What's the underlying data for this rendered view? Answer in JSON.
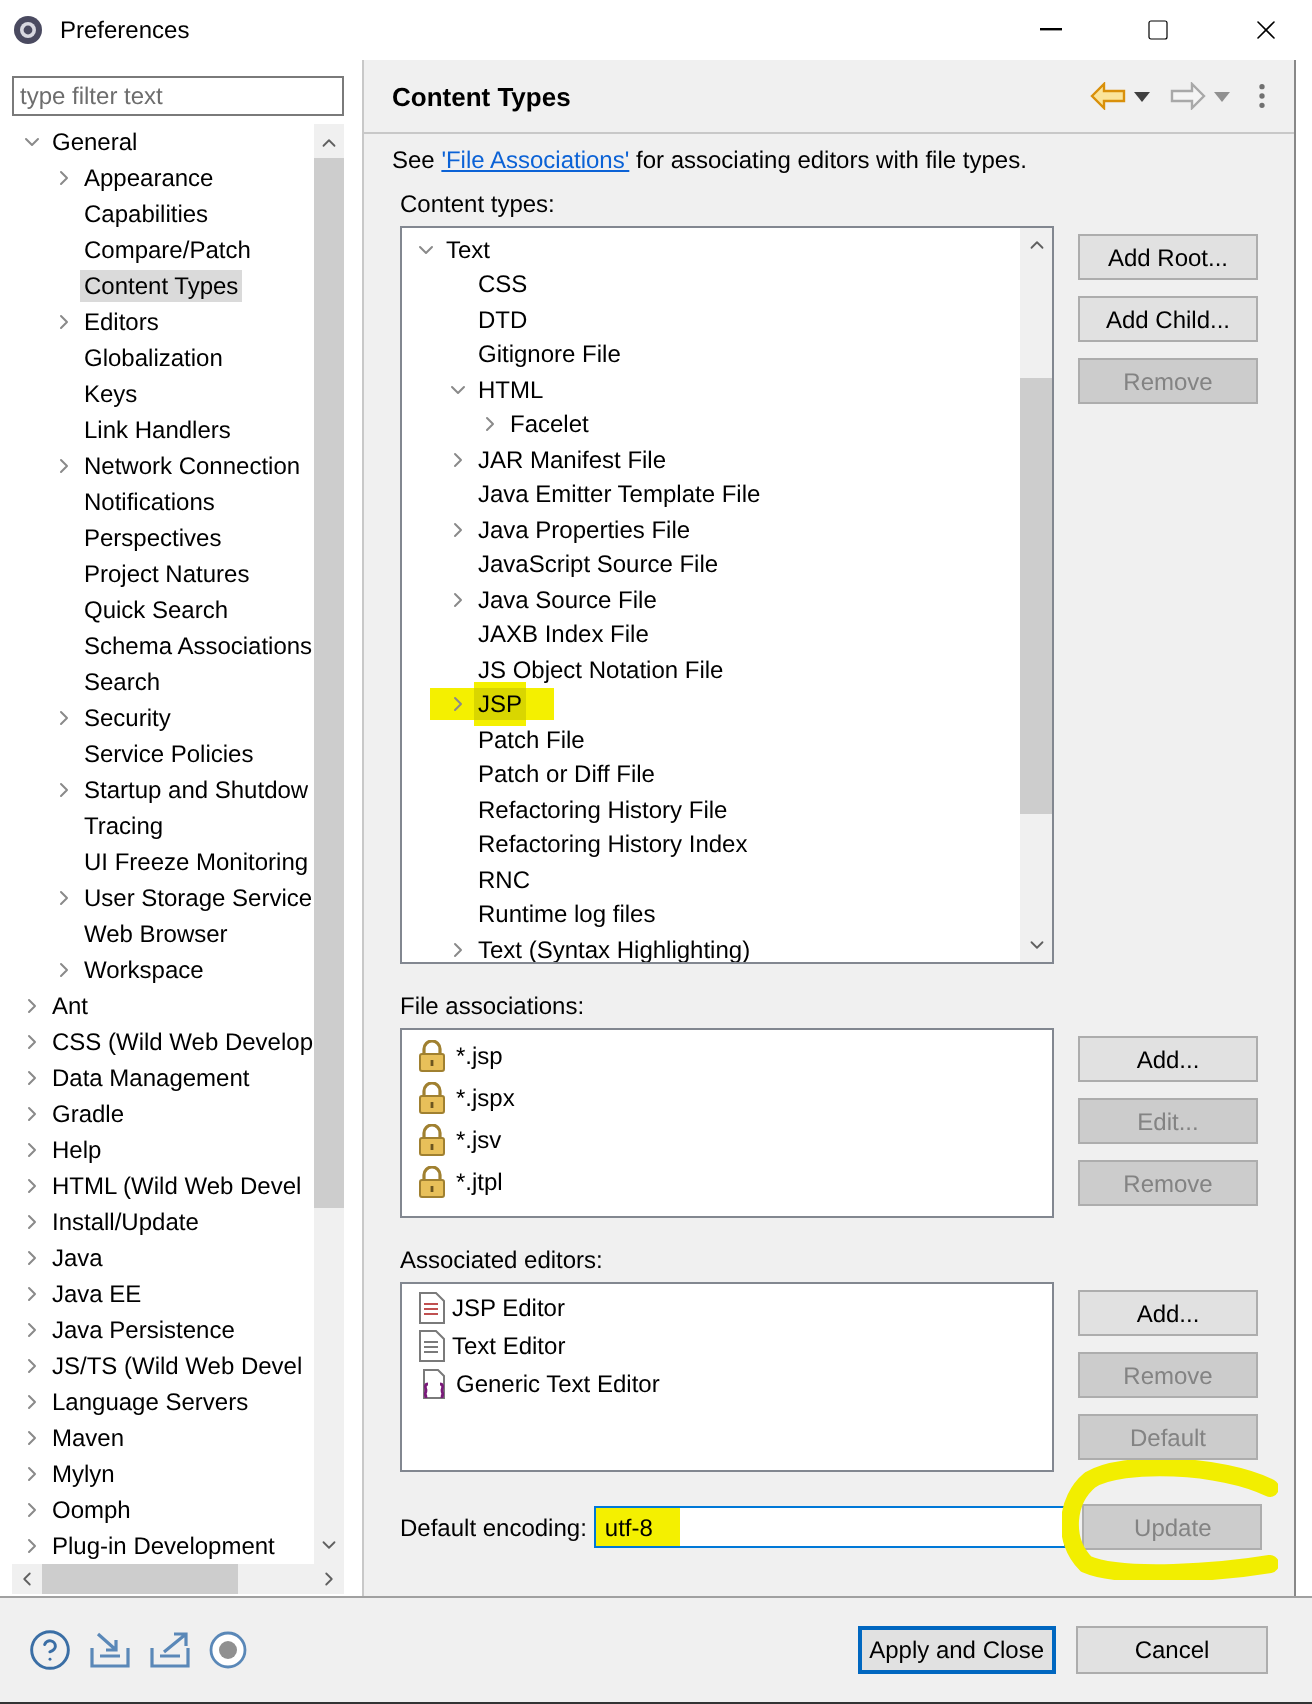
{
  "window": {
    "title": "Preferences"
  },
  "filter": {
    "placeholder": "type filter text"
  },
  "nav_tree": [
    {
      "label": "General",
      "expanded": true,
      "selected": false,
      "children": [
        {
          "label": "Appearance",
          "expanded": false,
          "selected": false
        },
        {
          "label": "Capabilities",
          "selected": false
        },
        {
          "label": "Compare/Patch",
          "selected": false
        },
        {
          "label": "Content Types",
          "selected": true
        },
        {
          "label": "Editors",
          "expanded": false,
          "selected": false
        },
        {
          "label": "Globalization",
          "selected": false
        },
        {
          "label": "Keys",
          "selected": false
        },
        {
          "label": "Link Handlers",
          "selected": false
        },
        {
          "label": "Network Connection",
          "expanded": false,
          "selected": false
        },
        {
          "label": "Notifications",
          "selected": false
        },
        {
          "label": "Perspectives",
          "selected": false
        },
        {
          "label": "Project Natures",
          "selected": false
        },
        {
          "label": "Quick Search",
          "selected": false
        },
        {
          "label": "Schema Associations",
          "selected": false
        },
        {
          "label": "Search",
          "selected": false
        },
        {
          "label": "Security",
          "expanded": false,
          "selected": false
        },
        {
          "label": "Service Policies",
          "selected": false
        },
        {
          "label": "Startup and Shutdow",
          "expanded": false,
          "selected": false
        },
        {
          "label": "Tracing",
          "selected": false
        },
        {
          "label": "UI Freeze Monitoring",
          "selected": false
        },
        {
          "label": "User Storage Service",
          "expanded": false,
          "selected": false
        },
        {
          "label": "Web Browser",
          "selected": false
        },
        {
          "label": "Workspace",
          "expanded": false,
          "selected": false
        }
      ]
    },
    {
      "label": "Ant",
      "expanded": false,
      "selected": false
    },
    {
      "label": "CSS (Wild Web Develop",
      "expanded": false,
      "selected": false
    },
    {
      "label": "Data Management",
      "expanded": false,
      "selected": false
    },
    {
      "label": "Gradle",
      "expanded": false,
      "selected": false
    },
    {
      "label": "Help",
      "expanded": false,
      "selected": false
    },
    {
      "label": "HTML (Wild Web Devel",
      "expanded": false,
      "selected": false
    },
    {
      "label": "Install/Update",
      "expanded": false,
      "selected": false
    },
    {
      "label": "Java",
      "expanded": false,
      "selected": false
    },
    {
      "label": "Java EE",
      "expanded": false,
      "selected": false
    },
    {
      "label": "Java Persistence",
      "expanded": false,
      "selected": false
    },
    {
      "label": "JS/TS (Wild Web Devel",
      "expanded": false,
      "selected": false
    },
    {
      "label": "Language Servers",
      "expanded": false,
      "selected": false
    },
    {
      "label": "Maven",
      "expanded": false,
      "selected": false
    },
    {
      "label": "Mylyn",
      "expanded": false,
      "selected": false
    },
    {
      "label": "Oomph",
      "expanded": false,
      "selected": false
    },
    {
      "label": "Plug-in Development",
      "expanded": false,
      "selected": false
    }
  ],
  "page": {
    "title": "Content Types",
    "intro": {
      "before": "See ",
      "link": "'File Associations'",
      "after": " for associating editors with file types."
    },
    "content_types": {
      "label": "Content types:",
      "tree": [
        {
          "label": "Text",
          "expanded": true,
          "selected": false,
          "children": [
            {
              "label": "CSS",
              "selected": false
            },
            {
              "label": "DTD",
              "selected": false
            },
            {
              "label": "Gitignore File",
              "selected": false
            },
            {
              "label": "HTML",
              "expanded": true,
              "selected": false,
              "children": [
                {
                  "label": "Facelet",
                  "expanded": false,
                  "selected": false
                }
              ]
            },
            {
              "label": "JAR Manifest File",
              "expanded": false,
              "selected": false
            },
            {
              "label": "Java Emitter Template File",
              "selected": false
            },
            {
              "label": "Java Properties File",
              "expanded": false,
              "selected": false
            },
            {
              "label": "JavaScript Source File",
              "selected": false
            },
            {
              "label": "Java Source File",
              "expanded": false,
              "selected": false
            },
            {
              "label": "JAXB Index File",
              "selected": false
            },
            {
              "label": "JS Object Notation File",
              "selected": false
            },
            {
              "label": "JSP",
              "expanded": false,
              "selected": true,
              "marked": true
            },
            {
              "label": "Patch File",
              "selected": false
            },
            {
              "label": "Patch or Diff File",
              "selected": false
            },
            {
              "label": "Refactoring History File",
              "selected": false
            },
            {
              "label": "Refactoring History Index",
              "selected": false
            },
            {
              "label": "RNC",
              "selected": false
            },
            {
              "label": "Runtime log files",
              "selected": false
            },
            {
              "label": "Text (Syntax Highlighting)",
              "expanded": false,
              "selected": false
            }
          ]
        }
      ],
      "buttons": [
        {
          "label": "Add Root...",
          "disabled": false
        },
        {
          "label": "Add Child...",
          "disabled": false
        },
        {
          "label": "Remove",
          "disabled": true
        }
      ]
    },
    "file_associations": {
      "label": "File associations:",
      "items": [
        {
          "label": "*.jsp",
          "locked": true
        },
        {
          "label": "*.jspx",
          "locked": true
        },
        {
          "label": "*.jsv",
          "locked": true
        },
        {
          "label": "*.jtpl",
          "locked": true
        }
      ],
      "buttons": [
        {
          "label": "Add...",
          "disabled": false
        },
        {
          "label": "Edit...",
          "disabled": true
        },
        {
          "label": "Remove",
          "disabled": true
        }
      ]
    },
    "associated_editors": {
      "label": "Associated editors:",
      "items": [
        {
          "label": "JSP Editor",
          "kind": "jsp"
        },
        {
          "label": "Text Editor",
          "kind": "text"
        },
        {
          "label": "Generic Text Editor",
          "kind": "generic"
        }
      ],
      "buttons": [
        {
          "label": "Add...",
          "disabled": false
        },
        {
          "label": "Remove",
          "disabled": true
        },
        {
          "label": "Default",
          "disabled": true
        }
      ]
    },
    "encoding": {
      "label": "Default encoding:",
      "value": "utf-8",
      "marked": true,
      "button": {
        "label": "Update",
        "disabled": true,
        "circled": true
      }
    }
  },
  "buttons": [
    {
      "label": "Apply and Close",
      "default": true
    },
    {
      "label": "Cancel",
      "default": false
    }
  ]
}
